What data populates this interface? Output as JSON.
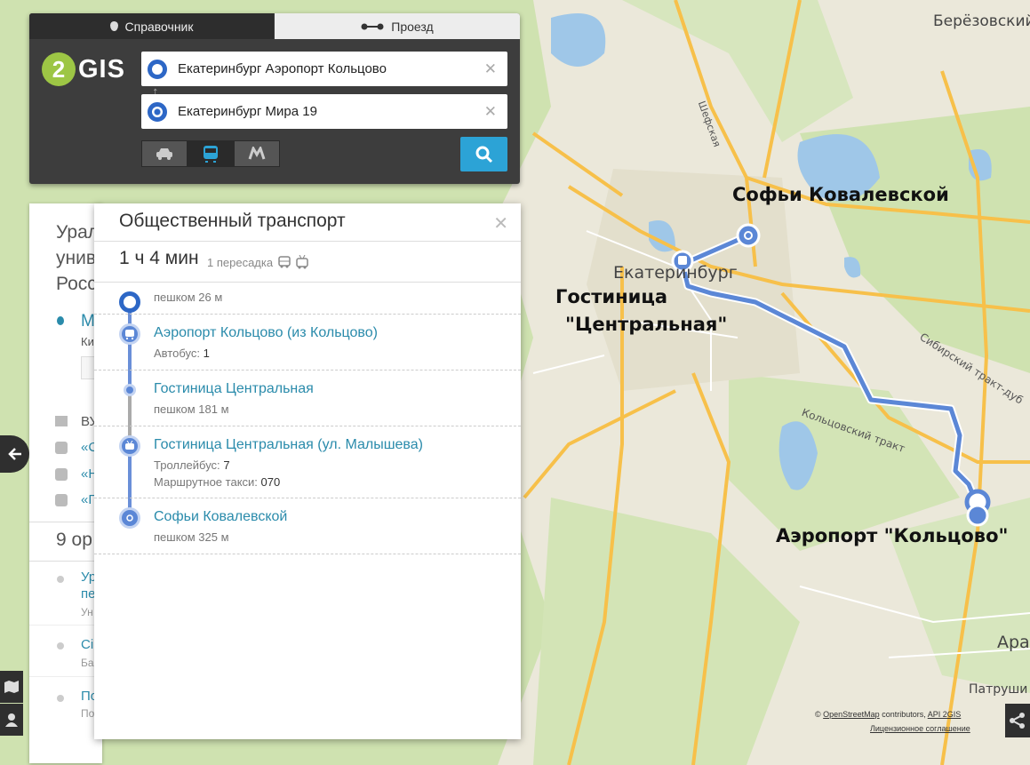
{
  "search": {
    "tabs": [
      "Справочник",
      "Проезд"
    ],
    "logo": "GIS",
    "logo_digit": "2",
    "from_value": "Екатеринбург Аэропорт Кольцово",
    "to_value": "Екатеринбург Мира 19",
    "clear_symbol": "✕",
    "modes": [
      "car",
      "bus",
      "metro"
    ],
    "active_mode": "bus"
  },
  "route_panel": {
    "title": "Общественный транспорт",
    "duration": "1 ч 4 мин",
    "transfers": "1 пересадка",
    "steps": [
      {
        "name": "",
        "sub": "пешком 26 м"
      },
      {
        "name": "Аэропорт Кольцово (из Кольцово)",
        "sub_label": "Автобус:",
        "sub_value": "1"
      },
      {
        "name": "Гостиница Центральная",
        "sub": "пешком 181 м"
      },
      {
        "name": "Гостиница Центральная (ул. Малышева)",
        "sub_label": "Троллейбус:",
        "sub_value": "7",
        "sub2_label": "Маршрутное такси:",
        "sub2_value": "070"
      },
      {
        "name": "Софьи Ковалевской",
        "sub": "пешком 325 м"
      }
    ]
  },
  "under_panel": {
    "title_lines": [
      "Урал",
      "унив",
      "Росс"
    ],
    "icon_rows": [
      "М",
      "Ки",
      "ВУ",
      "«С",
      "«Н",
      "«Г"
    ],
    "count": "9 ор",
    "list": [
      {
        "title": "Ур",
        "title2": "пе",
        "sub": "Ун"
      },
      {
        "title": "Сі",
        "sub": "Ба"
      },
      {
        "title": "По",
        "sub": "По"
      }
    ]
  },
  "map_labels": {
    "city": "Екатеринбург",
    "berezovsky": "Берёзовский",
    "shefskaya": "Шефская",
    "sibirsky": "Сибирский тракт-дуб",
    "koltsovsky": "Кольцовский тракт",
    "patrushi": "Патруши",
    "aramil": "Ара"
  },
  "annotations": {
    "sofia": "Софьи Ковалевской",
    "hotel_line1": "Гостиница",
    "hotel_line2": "\"Центральная\"",
    "airport": "Аэропорт \"Кольцово\""
  },
  "credits": {
    "prefix": "©",
    "osm": "OpenStreetMap",
    "contributors": " contributors, ",
    "api": "API 2GIS",
    "license": "Лицензионное соглашение"
  },
  "colors": {
    "route": "#5b87d6",
    "accent": "#2ca3d6",
    "logo": "#9dc645",
    "panel_dark": "#3d3d3d"
  }
}
